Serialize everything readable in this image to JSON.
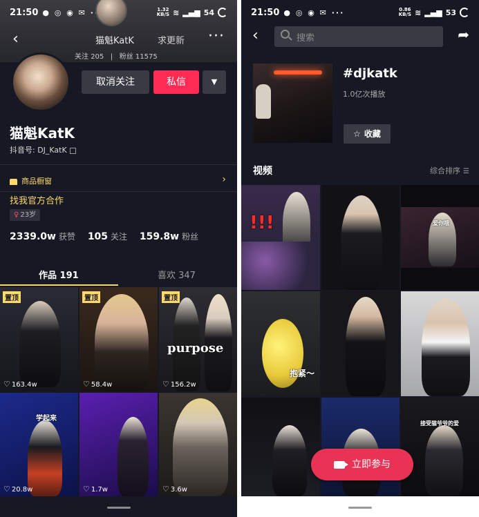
{
  "left": {
    "status_bar": {
      "time": "21:50",
      "speed_top": "1.32",
      "speed_unit": "KB/S",
      "battery": "54"
    },
    "top_nav": {
      "title_name": "猫魁KatK",
      "update_text": "求更新",
      "following_label": "关注",
      "following_count": "205",
      "fans_label": "粉丝",
      "fans_count": "11575"
    },
    "actions": {
      "unfollow": "取消关注",
      "message": "私信",
      "dropdown": "▼"
    },
    "profile": {
      "name": "猫魁KatK",
      "id_label": "抖音号: DJ_KatK"
    },
    "shop": {
      "label": "商品橱窗",
      "arrow": "›"
    },
    "cooperation": "找我官方合作",
    "age": "23岁",
    "stats": [
      {
        "value": "2339.0w",
        "label": "获赞"
      },
      {
        "value": "105",
        "label": "关注"
      },
      {
        "value": "159.8w",
        "label": "粉丝"
      }
    ],
    "tabs": {
      "works": "作品 191",
      "likes": "喜欢 347"
    },
    "videos": [
      {
        "pinned": "置顶",
        "likes": "163.4w",
        "caption": ""
      },
      {
        "pinned": "置顶",
        "likes": "58.4w",
        "caption": ""
      },
      {
        "pinned": "置顶",
        "likes": "156.2w",
        "caption": "purpose"
      },
      {
        "pinned": "",
        "likes": "20.8w",
        "caption": "学起来"
      },
      {
        "pinned": "",
        "likes": "1.7w",
        "caption": ""
      },
      {
        "pinned": "",
        "likes": "3.6w",
        "caption": ""
      }
    ]
  },
  "right": {
    "status_bar": {
      "time": "21:50",
      "speed_top": "0.86",
      "speed_unit": "KB/S",
      "battery": "53"
    },
    "search": {
      "placeholder": "搜索"
    },
    "hashtag": {
      "title": "#djkatk",
      "plays": "1.0亿次播放",
      "favorite": "收藏"
    },
    "section": {
      "title": "视频",
      "sort": "综合排序"
    },
    "videos": [
      {
        "caption": ""
      },
      {
        "caption": ""
      },
      {
        "caption": "爱你哦"
      },
      {
        "caption": "抱紧～"
      },
      {
        "caption": ""
      },
      {
        "caption": ""
      },
      {
        "caption": ""
      },
      {
        "caption": ""
      },
      {
        "caption": "接受猫爷爷的爱"
      }
    ],
    "join_button": "立即参与"
  },
  "colors": {
    "bg": "#161823",
    "accent_red": "#fe2c55",
    "accent_yellow": "#fdd96b",
    "button_gray": "#3a3a44"
  }
}
